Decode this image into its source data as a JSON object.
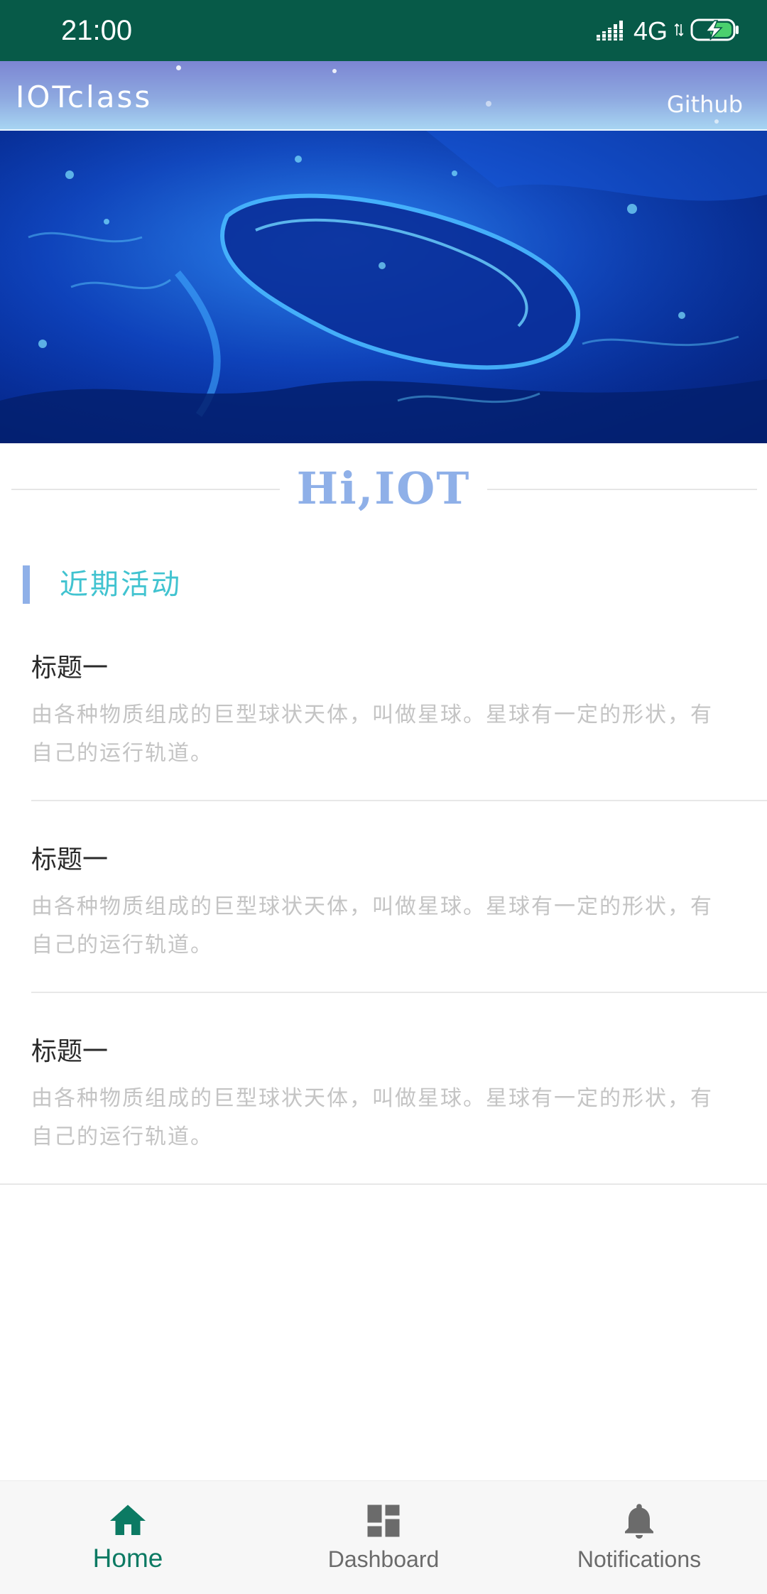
{
  "status_bar": {
    "time": "21:00",
    "network": "4G",
    "signal_icon": "signal-bars-icon",
    "battery_icon": "battery-charging-icon"
  },
  "header": {
    "title": "IOTclass",
    "link_label": "Github"
  },
  "banner": {
    "image_icon": "underwater-banner-image"
  },
  "greeting": {
    "text": "Hi,IOT"
  },
  "section": {
    "title": "近期活动"
  },
  "articles": [
    {
      "title": "标题一",
      "body": "由各种物质组成的巨型球状天体，叫做星球。星球有一定的形状，有自己的运行轨道。"
    },
    {
      "title": "标题一",
      "body": "由各种物质组成的巨型球状天体，叫做星球。星球有一定的形状，有自己的运行轨道。"
    },
    {
      "title": "标题一",
      "body": "由各种物质组成的巨型球状天体，叫做星球。星球有一定的形状，有自己的运行轨道。"
    }
  ],
  "bottom_nav": {
    "items": [
      {
        "label": "Home",
        "icon": "home-icon",
        "active": true
      },
      {
        "label": "Dashboard",
        "icon": "dashboard-icon",
        "active": false
      },
      {
        "label": "Notifications",
        "icon": "bell-icon",
        "active": false
      }
    ]
  },
  "colors": {
    "status_bar": "#075a48",
    "accent": "#0c7a63",
    "section_title": "#41c3d0",
    "greeting": "#8fb0e8",
    "body_text": "#c4c4c4"
  }
}
